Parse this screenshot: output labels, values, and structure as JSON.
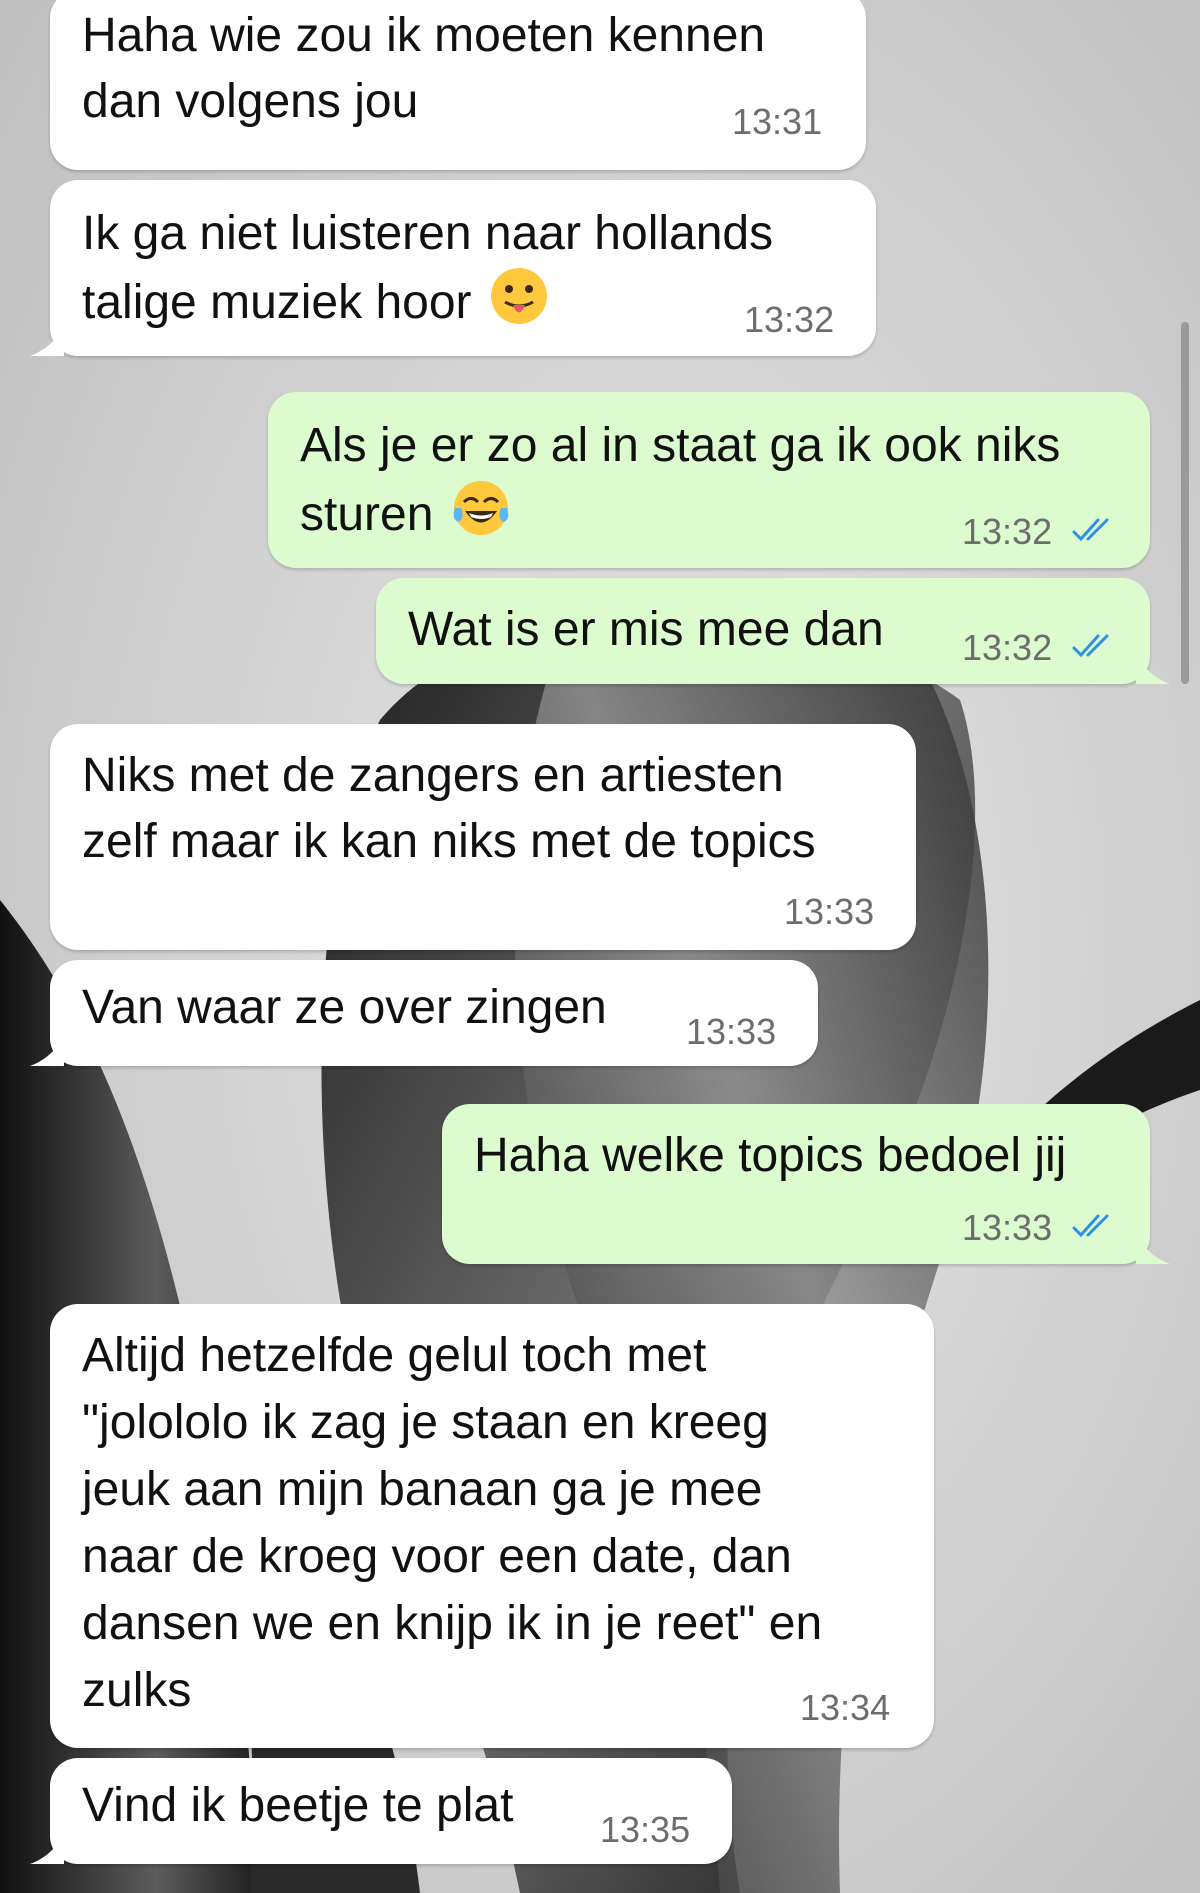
{
  "messages": [
    {
      "id": "m1",
      "direction": "incoming",
      "lines": [
        "Haha wie zou ik moeten kennen",
        "dan volgens jou"
      ],
      "time": "13:31"
    },
    {
      "id": "m2",
      "direction": "incoming",
      "lines": [
        "Ik ga niet luisteren naar hollands",
        "talige muziek hoor"
      ],
      "emoji": "face-with-tongue",
      "time": "13:32"
    },
    {
      "id": "m3",
      "direction": "outgoing",
      "lines": [
        "Als je er zo al in staat ga ik ook niks",
        "sturen"
      ],
      "emoji": "face-with-tears-of-joy",
      "time": "13:32",
      "status": "read"
    },
    {
      "id": "m4",
      "direction": "outgoing",
      "lines": [
        "Wat is er mis mee dan"
      ],
      "time": "13:32",
      "status": "read"
    },
    {
      "id": "m5",
      "direction": "incoming",
      "lines": [
        "Niks met de zangers en artiesten",
        "zelf maar ik kan niks met de topics"
      ],
      "time": "13:33"
    },
    {
      "id": "m6",
      "direction": "incoming",
      "lines": [
        "Van waar ze over zingen"
      ],
      "time": "13:33"
    },
    {
      "id": "m7",
      "direction": "outgoing",
      "lines": [
        "Haha welke topics bedoel jij"
      ],
      "time": "13:33",
      "status": "read"
    },
    {
      "id": "m8",
      "direction": "incoming",
      "lines": [
        "Altijd hetzelfde gelul toch met",
        "\"jolololo ik zag je staan en kreeg",
        "jeuk aan mijn banaan ga je mee",
        "naar de kroeg voor een date, dan",
        "dansen we en knijp ik in je reet\" en",
        "zulks"
      ],
      "time": "13:34"
    },
    {
      "id": "m9",
      "direction": "incoming",
      "lines": [
        "Vind ik beetje te plat"
      ],
      "time": "13:35"
    }
  ],
  "colors": {
    "incoming_bubble": "#ffffff",
    "outgoing_bubble": "#dcfcd0",
    "read_ticks": "#2f8fe6",
    "timestamp": "#6d6d6d"
  },
  "icons": {
    "read_receipt": "double-check-icon",
    "wallpaper": "black-and-white-tulip-wallpaper"
  }
}
